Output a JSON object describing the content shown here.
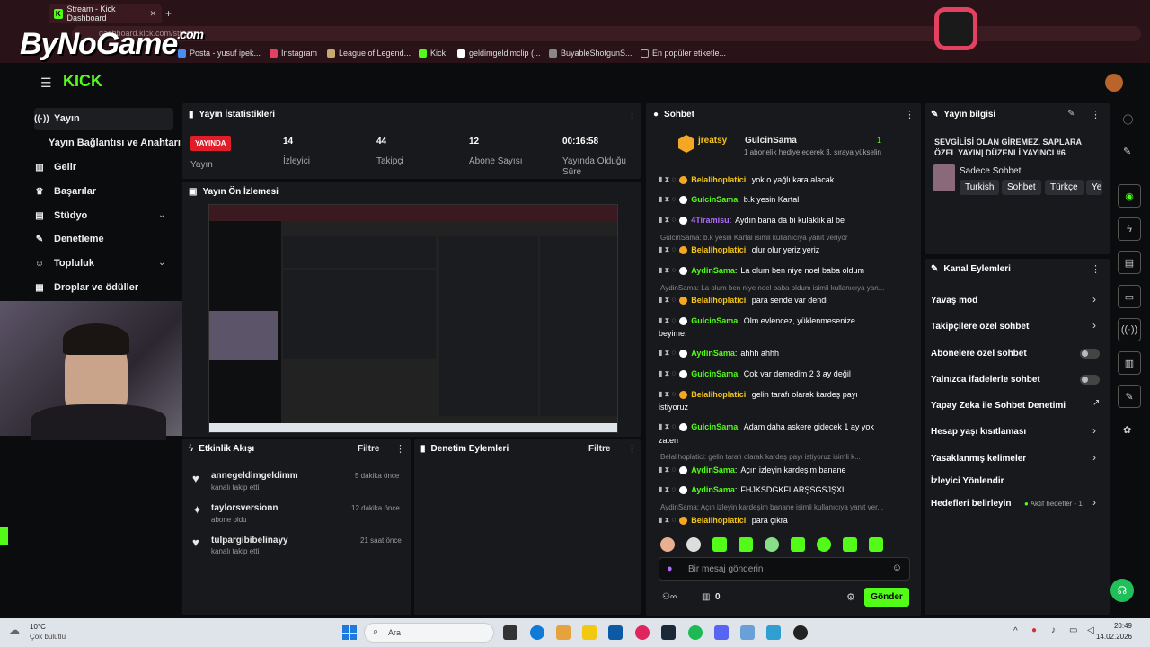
{
  "browser": {
    "tab_title": "Stream - Kick Dashboard",
    "url": "dashboard.kick.com/stream",
    "bookmarks": [
      "Posta - yusuf ipek...",
      "Instagram",
      "League of Legend...",
      "Kick",
      "geldimgeldimclip (...",
      "BuyableShotgunS...",
      "En popüler etiketle..."
    ]
  },
  "brand": {
    "overlay": "ByNoGame",
    "overlay_dot": ".com",
    "kick": "KICK"
  },
  "sidebar": {
    "items": [
      {
        "label": "Yayın",
        "icon": "broadcast-icon"
      },
      {
        "label": "Yayın Bağlantısı ve Anahtarı",
        "icon": ""
      },
      {
        "label": "Gelir",
        "icon": "revenue-icon"
      },
      {
        "label": "Başarılar",
        "icon": "trophy-icon"
      },
      {
        "label": "Stüdyo",
        "icon": "studio-icon"
      },
      {
        "label": "Denetleme",
        "icon": "wrench-icon"
      },
      {
        "label": "Topluluk",
        "icon": "community-icon"
      },
      {
        "label": "Droplar ve ödüller",
        "icon": "gift-icon"
      }
    ]
  },
  "stats": {
    "title": "Yayın İstatistikleri",
    "live": "YAYINDA",
    "live_label": "Yayın",
    "viewers": "14",
    "viewers_label": "İzleyici",
    "followers": "44",
    "followers_label": "Takipçi",
    "subs": "12",
    "subs_label": "Abone Sayısı",
    "uptime": "00:16:58",
    "uptime_label": "Yayında Olduğu Süre"
  },
  "preview": {
    "title": "Yayın Ön İzlemesi"
  },
  "activity": {
    "title": "Etkinlik Akışı",
    "filter": "Filtre",
    "items": [
      {
        "name": "annegeldimgeldimm",
        "action": "kanalı takip etti",
        "time": "5 dakika önce"
      },
      {
        "name": "taylorsversionn",
        "action": "abone oldu",
        "time": "12 dakika önce"
      },
      {
        "name": "tulpargibibelinayy",
        "action": "kanalı takip etti",
        "time": "21 saat önce"
      }
    ]
  },
  "moderation": {
    "title": "Denetim Eylemleri",
    "filter": "Filtre"
  },
  "chat": {
    "title": "Sohbet",
    "pinned_user": "jreatsy",
    "pinned_target": "GulcinSama",
    "pinned_count": "1",
    "pinned_msg": "1 abonelik hediye ederek 3. sıraya yükselin",
    "messages": [
      {
        "name": "Belalihoplatici",
        "text": "yok o yağlı kara alacak",
        "color": "y"
      },
      {
        "name": "GulcinSama",
        "text": "b.k yesin Kartal",
        "color": "g"
      },
      {
        "name": "4Tiramisu",
        "text": "Aydın bana da bi kulaklık al be",
        "color": "p"
      },
      {
        "name": "Belalihoplatici",
        "text": "olur olur yeriz yeriz",
        "color": "y"
      },
      {
        "name": "AydinSama",
        "text": "La olum ben niye noel baba oldum",
        "color": "g"
      },
      {
        "name": "Belalihoplatici",
        "text": "para sende var dendi",
        "color": "y"
      },
      {
        "name": "GulcinSama",
        "text": "Olm evlencez, yüklenmesenize",
        "color": "g"
      },
      {
        "name": "AydinSama",
        "text": "ahhh ahhh",
        "color": "g"
      },
      {
        "name": "GulcinSama",
        "text": "Çok var demedim 2 3 ay değil",
        "color": "g"
      },
      {
        "name": "Belalihoplatici",
        "text": "gelin tarafı olarak kardeş payı",
        "color": "y"
      },
      {
        "name": "GulcinSama",
        "text": "Adam daha askere gidecek 1 ay yok",
        "color": "g"
      },
      {
        "name": "AydinSama",
        "text": "Açın izleyin kardeşim banane",
        "color": "g"
      },
      {
        "name": "AydinSama",
        "text": "FHJKSDGKFLARŞSGSJŞXL",
        "color": "g"
      },
      {
        "name": "Belalihoplatici",
        "text": "para çıkra",
        "color": "y"
      }
    ],
    "cont": [
      "beyime.",
      "istiyoruz",
      "zaten"
    ],
    "replies": [
      "GulcinSama: b.k yesin Kartal isimli kullanıcıya yanıt veriyor",
      "AydinSama: La olum ben niye noel baba oldum isimli kullanıcıya yan...",
      "Belalihoplatici: gelin tarafı olarak kardeş payı istiyoruz isimli k...",
      "AydinSama: Açın izleyin kardeşim banane isimli kullanıcıya yanıt ver..."
    ],
    "input_placeholder": "Bir mesaj gönderin",
    "count": "0",
    "send": "Gönder"
  },
  "stream_info": {
    "title": "Yayın bilgisi",
    "stream_title": "SEVGİLİSİ OLAN GİREMEZ. SAPLARA ÖZEL YAYIN| DÜZENLİ YAYINCI #6",
    "category": "Sadece Sohbet",
    "tags": [
      "Turkish",
      "Sohbet",
      "Türkçe",
      "Ye"
    ]
  },
  "channel_actions": {
    "title": "Kanal Eylemleri",
    "items": [
      "Yavaş mod",
      "Takipçilere özel sohbet",
      "Abonelere özel sohbet",
      "Yalnızca ifadelerle sohbet",
      "Yapay Zeka ile Sohbet Denetimi",
      "Hesap yaşı kısıtlaması",
      "Yasaklanmış kelimeler",
      "İzleyici Yönlendir",
      "Hedefleri belirleyin"
    ],
    "goals_status": "Aktif hedefler - 1"
  },
  "taskbar": {
    "weather_temp": "10°C",
    "weather_desc": "Çok bulutlu",
    "search": "Ara",
    "time": "20:49",
    "date": "14.02.2026"
  }
}
